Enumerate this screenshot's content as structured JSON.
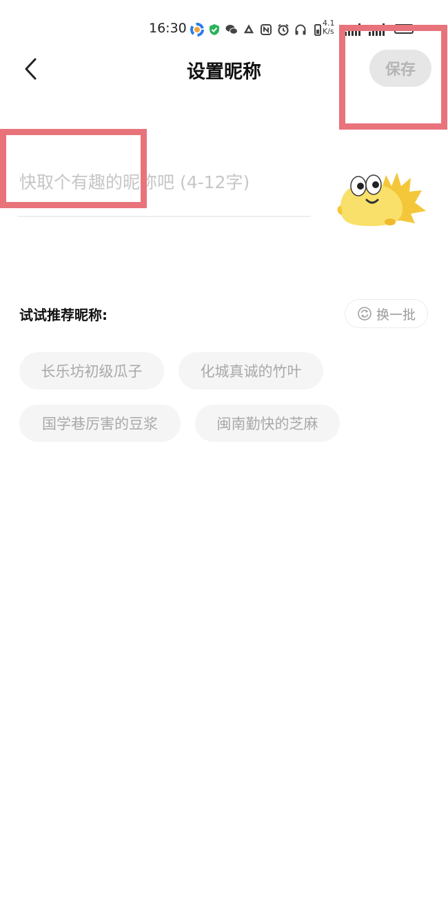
{
  "status_bar": {
    "time": "16:30",
    "net_speed_value": "4.1",
    "net_speed_unit": "K/s",
    "icons": [
      "app-shortcut-icon",
      "shield-check-icon",
      "wechat-icon",
      "recycle-icon",
      "nfc-icon",
      "alarm-icon",
      "headphones-icon",
      "battery-saver-icon",
      "signal-icon",
      "signal-icon",
      "battery-icon"
    ]
  },
  "header": {
    "title": "设置昵称",
    "save_label": "保存"
  },
  "nickname": {
    "value": "",
    "placeholder": "快取个有趣的昵称吧 (4-12字)"
  },
  "suggestions": {
    "title": "试试推荐昵称:",
    "refresh_label": "换一批",
    "items": [
      "长乐坊初级瓜子",
      "化城真诚的竹叶",
      "国学巷厉害的豆浆",
      "闽南勤快的芝麻"
    ]
  },
  "colors": {
    "annotation": "#e8737b",
    "save_bg": "#e6e6e6",
    "chip_bg": "#f5f5f5",
    "mascot": "#f7d64a"
  }
}
